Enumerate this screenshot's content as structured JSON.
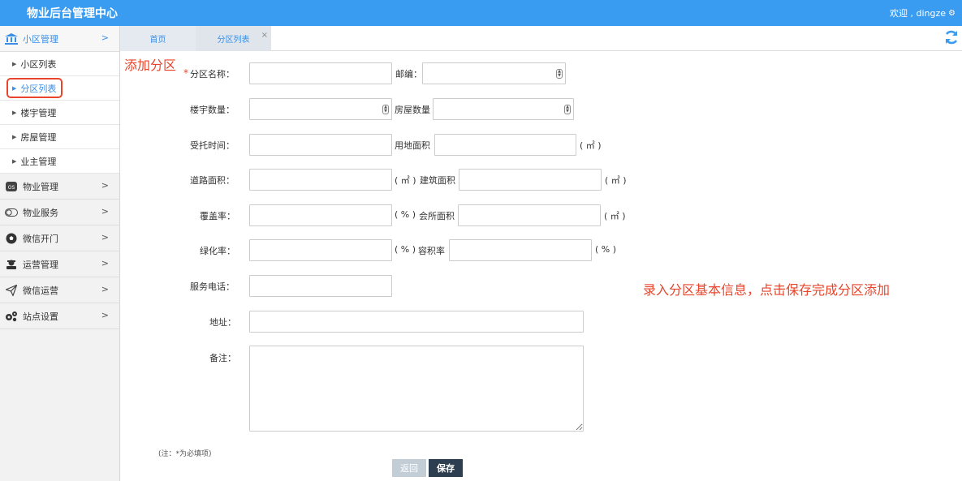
{
  "header": {
    "app_title": "物业后台管理中心",
    "welcome": "欢迎 , dingze"
  },
  "sidebar": {
    "groups": [
      {
        "label": "小区管理",
        "icon": "bank-icon",
        "expanded": true
      },
      {
        "label": "物业管理",
        "icon": "os-badge-icon"
      },
      {
        "label": "物业服务",
        "icon": "toggle-icon"
      },
      {
        "label": "微信开门",
        "icon": "soccer-ball-icon"
      },
      {
        "label": "运营管理",
        "icon": "support-agent-icon"
      },
      {
        "label": "微信运营",
        "icon": "paper-plane-icon"
      },
      {
        "label": "站点设置",
        "icon": "gears-icon"
      }
    ],
    "sub_items": [
      {
        "label": "小区列表"
      },
      {
        "label": "分区列表",
        "current": true
      },
      {
        "label": "楼宇管理"
      },
      {
        "label": "房屋管理"
      },
      {
        "label": "业主管理"
      }
    ]
  },
  "tabs": {
    "home": "首页",
    "zone": "分区列表",
    "close": "×"
  },
  "annotations": {
    "title": "添加分区",
    "note": "录入分区基本信息，点击保存完成分区添加"
  },
  "form": {
    "required_mark": "*",
    "zone_name": "分区名称：",
    "postcode": "邮编：",
    "building_count": "楼宇数量：",
    "house_count": "房屋数量",
    "entrust_time": "受托时间：",
    "land_area": "用地面积",
    "road_area": "道路面积：",
    "construction_area": "建筑面积",
    "coverage_rate": "覆盖率：",
    "clubhouse_area": "会所面积",
    "greening_rate": "绿化率：",
    "plot_ratio": "容积率",
    "service_phone": "服务电话：",
    "address": "地址：",
    "remarks": "备注：",
    "unit_sqm": "( ㎡ )",
    "unit_percent": "( % )",
    "footnote": "(注：*为必填项)",
    "back_button": "返回",
    "save_button": "保存"
  }
}
